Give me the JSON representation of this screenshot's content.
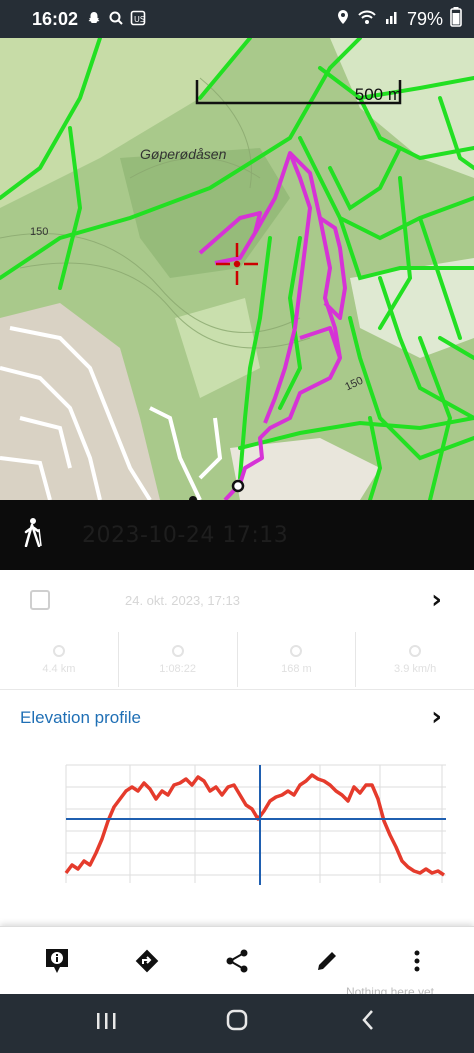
{
  "status_bar": {
    "time": "16:02",
    "left_icons": [
      "snapchat-icon",
      "search-icon",
      "lock-screen-icon"
    ],
    "battery": "79%"
  },
  "map": {
    "scale_label": "500 m",
    "place_name": "Gøperødåsen",
    "contour_labels": [
      "150",
      "150"
    ]
  },
  "activity": {
    "type_icon": "hiking-icon",
    "title": "2023-10-24 17:13"
  },
  "info_row": {
    "faded_text": "24. okt. 2023, 17:13"
  },
  "stats": [
    {
      "icon": "distance-icon",
      "value": "4.4 km"
    },
    {
      "icon": "clock-icon",
      "value": "1:08:22"
    },
    {
      "icon": "ascent-icon",
      "value": "168 m"
    },
    {
      "icon": "speed-icon",
      "value": "3.9 km/h"
    }
  ],
  "elevation": {
    "header": "Elevation profile"
  },
  "toolbar": {
    "buttons": [
      "info-icon",
      "directions-icon",
      "share-icon",
      "edit-icon",
      "more-icon"
    ]
  },
  "faded_footer": "Nothing here yet",
  "colors": {
    "map_green_trail": "#22e022",
    "track_magenta": "#d633d6",
    "elevation_line": "#e53b2c",
    "cursor_line": "#1f5fb0",
    "accent_blue": "#1f6fb5"
  }
}
